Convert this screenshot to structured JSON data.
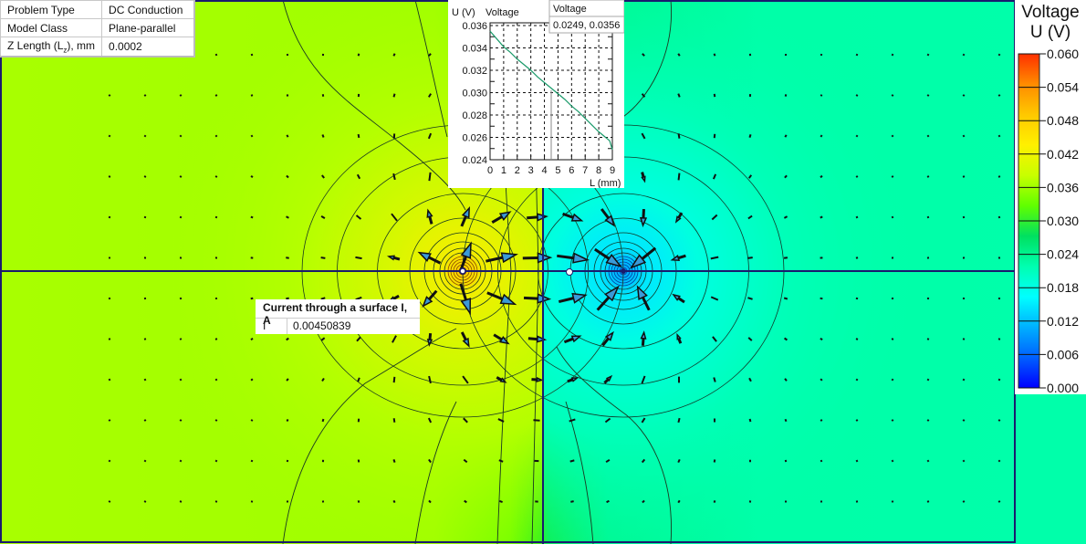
{
  "properties": [
    {
      "key": "Problem Type",
      "value": "DC Conduction"
    },
    {
      "key": "Model Class",
      "value": "Plane-parallel"
    },
    {
      "key": "Z Length (L_z), mm",
      "key_main": "Z Length (L",
      "key_sub": "z",
      "key_tail": "), mm",
      "value": "0.0002"
    }
  ],
  "current_result": {
    "title": "Current through a surface I, A",
    "label": "I",
    "value": "0.00450839"
  },
  "plot": {
    "y_axis_label": "U (V)",
    "series_title": "Voltage",
    "x_axis_label": "L (mm)",
    "tooltip_title": "Voltage",
    "tooltip_value": "0.0249, 0.0356",
    "cursor_x": 4.5
  },
  "chart_data": {
    "type": "line",
    "title": "Voltage",
    "xlabel": "L (mm)",
    "ylabel": "U (V)",
    "xlim": [
      0,
      9
    ],
    "ylim": [
      0.024,
      0.036
    ],
    "x_ticks": [
      "0",
      "1",
      "2",
      "3",
      "4",
      "5",
      "6",
      "7",
      "8",
      "9"
    ],
    "y_ticks": [
      "0.024",
      "0.026",
      "0.028",
      "0.030",
      "0.032",
      "0.034",
      "0.036"
    ],
    "grid": true,
    "series": [
      {
        "name": "Voltage",
        "color": "#1a9a6a",
        "x": [
          0,
          0.5,
          1,
          1.5,
          2,
          2.5,
          3,
          3.5,
          4,
          4.5,
          5,
          5.5,
          6,
          6.5,
          7,
          7.5,
          8,
          8.5,
          8.8,
          9
        ],
        "y": [
          0.0355,
          0.0348,
          0.0341,
          0.0336,
          0.033,
          0.0325,
          0.032,
          0.0314,
          0.0309,
          0.0304,
          0.0299,
          0.0294,
          0.0288,
          0.0283,
          0.0277,
          0.0271,
          0.0265,
          0.026,
          0.0257,
          0.0249
        ]
      }
    ]
  },
  "legend": {
    "title_line1": "Voltage",
    "title_line2": "U (V)",
    "ticks": [
      "0.060",
      "0.054",
      "0.048",
      "0.042",
      "0.036",
      "0.030",
      "0.024",
      "0.018",
      "0.012",
      "0.006",
      "0.000"
    ],
    "colors": [
      "#ff3000",
      "#ff8c00",
      "#ffc800",
      "#fff000",
      "#c8ff00",
      "#60ff00",
      "#00e060",
      "#00ffb0",
      "#00ffff",
      "#00b0ff",
      "#0060ff",
      "#0000ff"
    ]
  },
  "field": {
    "frame_color": "#1a1a6e",
    "source_color": "#ffff00",
    "sink_color": "#00f0ff"
  }
}
